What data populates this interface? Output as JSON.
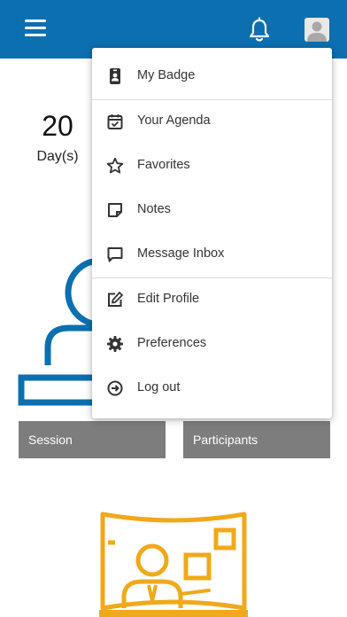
{
  "header": {
    "menu_icon": "hamburger-icon",
    "notification_icon": "bell-icon",
    "profile_icon": "avatar-icon",
    "background_color": "#0b6fb0"
  },
  "countdown": {
    "number": "20",
    "unit": "Day(s)"
  },
  "tiles": {
    "session_label": "Session",
    "participants_label": "Participants",
    "tile_color": "#7d7d7d"
  },
  "art": {
    "session_color": "#0b6fb0",
    "speaker_color": "#f0a91b"
  },
  "dropdown_menu": {
    "items": [
      {
        "label": "My Badge",
        "icon": "badge-icon"
      },
      {
        "label": "Your Agenda",
        "icon": "calendar-check-icon"
      },
      {
        "label": "Favorites",
        "icon": "star-icon"
      },
      {
        "label": "Notes",
        "icon": "note-icon"
      },
      {
        "label": "Message Inbox",
        "icon": "chat-icon"
      },
      {
        "label": "Edit Profile",
        "icon": "edit-icon"
      },
      {
        "label": "Preferences",
        "icon": "gear-icon"
      },
      {
        "label": "Log out",
        "icon": "logout-icon"
      }
    ]
  }
}
